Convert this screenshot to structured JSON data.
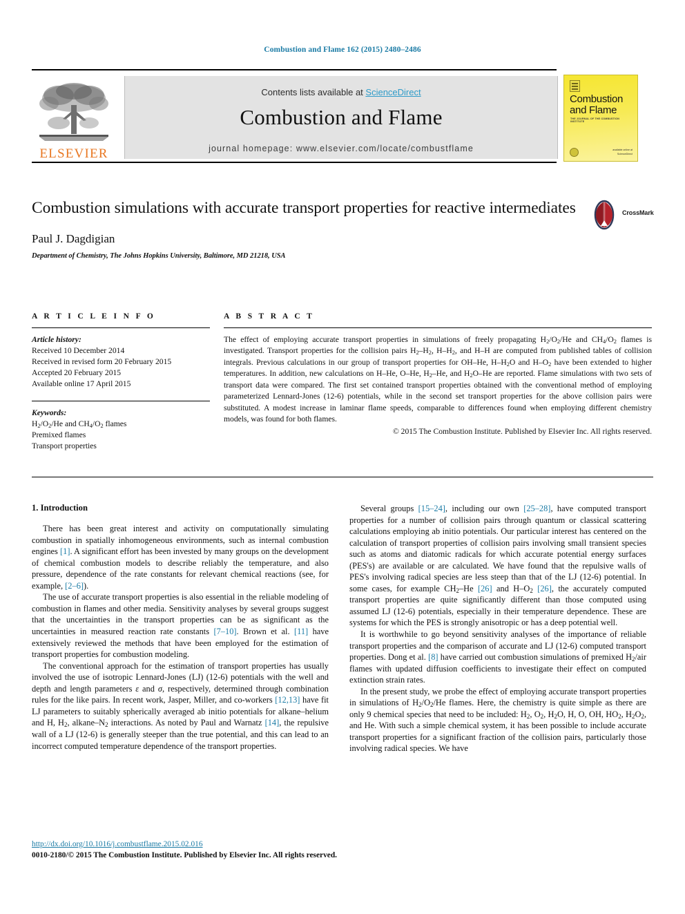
{
  "running_head": "Combustion and Flame 162 (2015) 2480–2486",
  "masthead": {
    "contents_prefix": "Contents lists available at ",
    "sciencedirect": "ScienceDirect",
    "journal_title": "Combustion and Flame",
    "homepage": "journal homepage: www.elsevier.com/locate/combustflame",
    "publisher_wordmark": "ELSEVIER",
    "cover": {
      "title_line1": "Combustion",
      "title_line2": "and Flame",
      "subtitle": "THE JOURNAL OF THE COMBUSTION INSTITUTE",
      "footer_line1": "available online at",
      "footer_line2": "ScienceDirect"
    },
    "colors": {
      "link": "#2e9bc9",
      "elsevier_orange": "#E87722",
      "band_gray": "#e3e3e3",
      "cover_yellow": "#f5e632"
    }
  },
  "article": {
    "title": "Combustion simulations with accurate transport properties for reactive intermediates",
    "crossmark_label": "CrossMark",
    "authors": "Paul J. Dagdigian",
    "affiliation": "Department of Chemistry, The Johns Hopkins University, Baltimore, MD 21218, USA"
  },
  "info": {
    "heading": "A R T I C L E   I N F O",
    "history_label": "Article history:",
    "history": [
      "Received 10 December 2014",
      "Received in revised form 20 February 2015",
      "Accepted 20 February 2015",
      "Available online 17 April 2015"
    ],
    "keywords_label": "Keywords:",
    "keywords": [
      "H2/O2/He and CH4/O2 flames",
      "Premixed flames",
      "Transport properties"
    ]
  },
  "abstract": {
    "heading": "A B S T R A C T",
    "text": "The effect of employing accurate transport properties in simulations of freely propagating H2/O2/He and CH4/O2 flames is investigated. Transport properties for the collision pairs H2–H2, H–H2, and H–H are computed from published tables of collision integrals. Previous calculations in our group of transport properties for OH–He, H–H2O and H–O2 have been extended to higher temperatures. In addition, new calculations on H–He, O–He, H2–He, and H2O–He are reported. Flame simulations with two sets of transport data were compared. The first set contained transport properties obtained with the conventional method of employing parameterized Lennard-Jones (12-6) potentials, while in the second set transport properties for the above collision pairs were substituted. A modest increase in laminar flame speeds, comparable to differences found when employing different chemistry models, was found for both flames.",
    "copyright": "© 2015 The Combustion Institute. Published by Elsevier Inc. All rights reserved."
  },
  "body": {
    "section_heading": "1. Introduction",
    "left_paragraphs": [
      "There has been great interest and activity on computationally simulating combustion in spatially inhomogeneous environments, such as internal combustion engines [1]. A significant effort has been invested by many groups on the development of chemical combustion models to describe reliably the temperature, and also pressure, dependence of the rate constants for relevant chemical reactions (see, for example, [2–6]).",
      "The use of accurate transport properties is also essential in the reliable modeling of combustion in flames and other media. Sensitivity analyses by several groups suggest that the uncertainties in the transport properties can be as significant as the uncertainties in measured reaction rate constants [7–10]. Brown et al. [11] have extensively reviewed the methods that have been employed for the estimation of transport properties for combustion modeling.",
      "The conventional approach for the estimation of transport properties has usually involved the use of isotropic Lennard-Jones (LJ) (12-6) potentials with the well and depth and length parameters ε and σ, respectively, determined through combination rules for the like pairs. In recent work, Jasper, Miller, and co-workers [12,13] have fit LJ parameters to suitably spherically averaged ab initio potentials for alkane–helium and H, H2, alkane–N2 interactions. As noted by Paul and Warnatz [14], the repulsive wall of a LJ (12-6) is generally steeper than the true potential, and this can lead to an incorrect computed temperature dependence of the transport properties."
    ],
    "right_paragraphs": [
      "Several groups [15–24], including our own [25–28], have computed transport properties for a number of collision pairs through quantum or classical scattering calculations employing ab initio potentials. Our particular interest has centered on the calculation of transport properties of collision pairs involving small transient species such as atoms and diatomic radicals for which accurate potential energy surfaces (PES's) are available or are calculated. We have found that the repulsive walls of PES's involving radical species are less steep than that of the LJ (12-6) potential. In some cases, for example CH2–He [26] and H–O2 [26], the accurately computed transport properties are quite significantly different than those computed using assumed LJ (12-6) potentials, especially in their temperature dependence. These are systems for which the PES is strongly anisotropic or has a deep potential well.",
      "It is worthwhile to go beyond sensitivity analyses of the importance of reliable transport properties and the comparison of accurate and LJ (12-6) computed transport properties. Dong et al. [8] have carried out combustion simulations of premixed H2/air flames with updated diffusion coefficients to investigate their effect on computed extinction strain rates.",
      "In the present study, we probe the effect of employing accurate transport properties in simulations of H2/O2/He flames. Here, the chemistry is quite simple as there are only 9 chemical species that need to be included: H2, O2, H2O, H, O, OH, HO2, H2O2, and He. With such a simple chemical system, it has been possible to include accurate transport properties for a significant fraction of the collision pairs, particularly those involving radical species. We have"
    ]
  },
  "footer": {
    "doi": "http://dx.doi.org/10.1016/j.combustflame.2015.02.016",
    "issn_line": "0010-2180/© 2015 The Combustion Institute. Published by Elsevier Inc. All rights reserved."
  }
}
